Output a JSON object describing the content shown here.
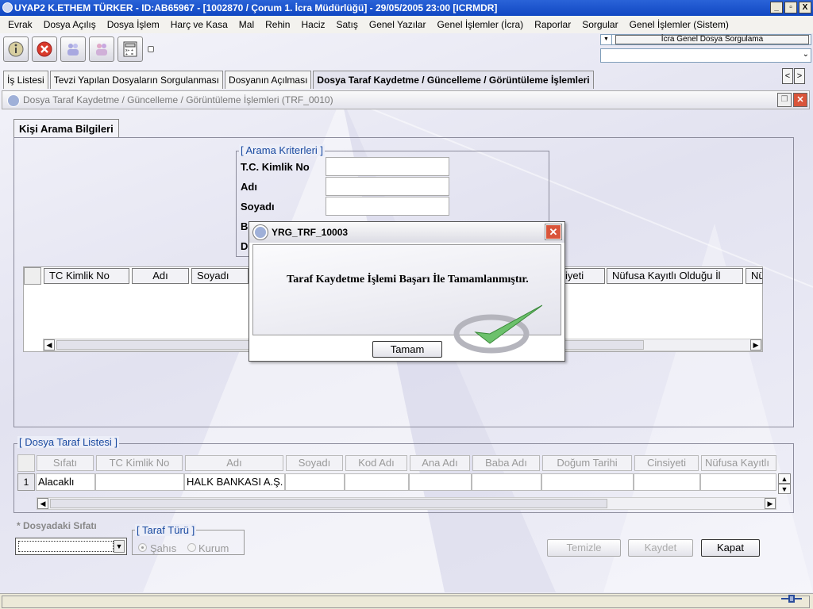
{
  "window": {
    "title": "UYAP2   K.ETHEM TÜRKER - ID:AB65967 - [1002870 / Çorum 1. İcra Müdürlüğü] - 29/05/2005 23:00 [ICRMDR]",
    "min": "_",
    "max": "▫",
    "close": "X"
  },
  "menu": [
    "Evrak",
    "Dosya Açılış",
    "Dosya İşlem",
    "Harç ve Kasa",
    "Mal",
    "Rehin",
    "Haciz",
    "Satış",
    "Genel Yazılar",
    "Genel İşlemler (İcra)",
    "Raporlar",
    "Sorgular",
    "Genel İşlemler (Sistem)"
  ],
  "toolbar": {
    "combo1": "İcra Genel Dosya Sorgulama",
    "combo2": ""
  },
  "tabs": [
    "İş Listesi",
    "Tevzi Yapılan Dosyaların Sorgulanması",
    "Dosyanın Açılması",
    "Dosya Taraf Kaydetme / Güncelleme / Görüntüleme İşlemleri"
  ],
  "nav": {
    "prev": "<",
    "next": ">"
  },
  "subwindow": {
    "title": "Dosya Taraf Kaydetme / Güncelleme / Görüntüleme İşlemleri (TRF_0010)"
  },
  "search": {
    "tab": "Kişi Arama Bilgileri",
    "legend": "[ Arama Kriterleri ]",
    "fields": [
      "T.C. Kimlik No",
      "Adı",
      "Soyadı",
      "B",
      "D"
    ],
    "columns": [
      "TC Kimlik No",
      "Adı",
      "Soyadı",
      "iyeti",
      "Nüfusa Kayıtlı Olduğu İl",
      "Nü"
    ]
  },
  "taraf": {
    "legend": "[ Dosya Taraf Listesi ]",
    "columns": [
      "Sıfatı",
      "TC Kimlik No",
      "Adı",
      "Soyadı",
      "Kod Adı",
      "Ana Adı",
      "Baba Adı",
      "Doğum Tarihi",
      "Cinsiyeti",
      "Nüfusa Kayıtlı"
    ],
    "rows": [
      {
        "no": "1",
        "sifati": "Alacaklı",
        "tc": "",
        "adi": "HALK BANKASI A.Ş."
      }
    ]
  },
  "form": {
    "sifat_label": "* Dosyadaki Sıfatı",
    "turu_legend": "[ Taraf Türü ]",
    "sahis": "Şahıs",
    "kurum": "Kurum"
  },
  "buttons": {
    "temizle": "Temizle",
    "kaydet": "Kaydet",
    "kapat": "Kapat"
  },
  "dialog": {
    "title": "YRG_TRF_10003",
    "message": "Taraf Kaydetme İşlemi Başarı İle Tamamlanmıştır.",
    "ok": "Tamam"
  }
}
